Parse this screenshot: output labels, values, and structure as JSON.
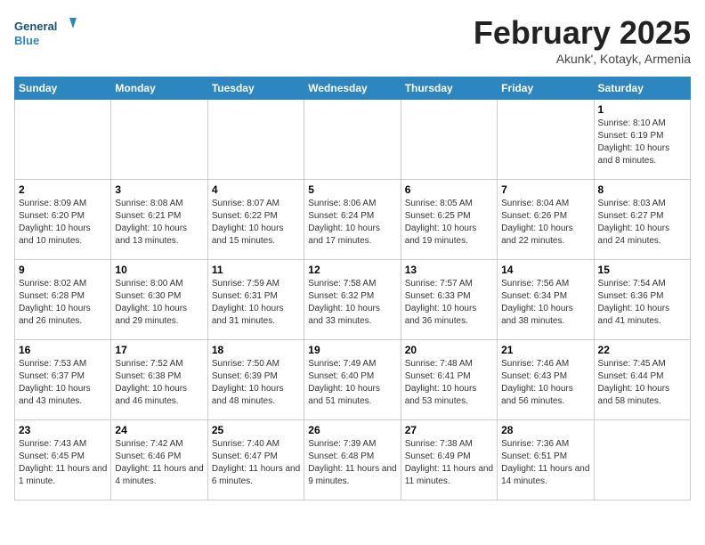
{
  "header": {
    "logo_line1": "General",
    "logo_line2": "Blue",
    "month": "February 2025",
    "location": "Akunk', Kotayk, Armenia"
  },
  "weekdays": [
    "Sunday",
    "Monday",
    "Tuesday",
    "Wednesday",
    "Thursday",
    "Friday",
    "Saturday"
  ],
  "weeks": [
    [
      {
        "day": "",
        "info": ""
      },
      {
        "day": "",
        "info": ""
      },
      {
        "day": "",
        "info": ""
      },
      {
        "day": "",
        "info": ""
      },
      {
        "day": "",
        "info": ""
      },
      {
        "day": "",
        "info": ""
      },
      {
        "day": "1",
        "info": "Sunrise: 8:10 AM\nSunset: 6:19 PM\nDaylight: 10 hours and 8 minutes."
      }
    ],
    [
      {
        "day": "2",
        "info": "Sunrise: 8:09 AM\nSunset: 6:20 PM\nDaylight: 10 hours and 10 minutes."
      },
      {
        "day": "3",
        "info": "Sunrise: 8:08 AM\nSunset: 6:21 PM\nDaylight: 10 hours and 13 minutes."
      },
      {
        "day": "4",
        "info": "Sunrise: 8:07 AM\nSunset: 6:22 PM\nDaylight: 10 hours and 15 minutes."
      },
      {
        "day": "5",
        "info": "Sunrise: 8:06 AM\nSunset: 6:24 PM\nDaylight: 10 hours and 17 minutes."
      },
      {
        "day": "6",
        "info": "Sunrise: 8:05 AM\nSunset: 6:25 PM\nDaylight: 10 hours and 19 minutes."
      },
      {
        "day": "7",
        "info": "Sunrise: 8:04 AM\nSunset: 6:26 PM\nDaylight: 10 hours and 22 minutes."
      },
      {
        "day": "8",
        "info": "Sunrise: 8:03 AM\nSunset: 6:27 PM\nDaylight: 10 hours and 24 minutes."
      }
    ],
    [
      {
        "day": "9",
        "info": "Sunrise: 8:02 AM\nSunset: 6:28 PM\nDaylight: 10 hours and 26 minutes."
      },
      {
        "day": "10",
        "info": "Sunrise: 8:00 AM\nSunset: 6:30 PM\nDaylight: 10 hours and 29 minutes."
      },
      {
        "day": "11",
        "info": "Sunrise: 7:59 AM\nSunset: 6:31 PM\nDaylight: 10 hours and 31 minutes."
      },
      {
        "day": "12",
        "info": "Sunrise: 7:58 AM\nSunset: 6:32 PM\nDaylight: 10 hours and 33 minutes."
      },
      {
        "day": "13",
        "info": "Sunrise: 7:57 AM\nSunset: 6:33 PM\nDaylight: 10 hours and 36 minutes."
      },
      {
        "day": "14",
        "info": "Sunrise: 7:56 AM\nSunset: 6:34 PM\nDaylight: 10 hours and 38 minutes."
      },
      {
        "day": "15",
        "info": "Sunrise: 7:54 AM\nSunset: 6:36 PM\nDaylight: 10 hours and 41 minutes."
      }
    ],
    [
      {
        "day": "16",
        "info": "Sunrise: 7:53 AM\nSunset: 6:37 PM\nDaylight: 10 hours and 43 minutes."
      },
      {
        "day": "17",
        "info": "Sunrise: 7:52 AM\nSunset: 6:38 PM\nDaylight: 10 hours and 46 minutes."
      },
      {
        "day": "18",
        "info": "Sunrise: 7:50 AM\nSunset: 6:39 PM\nDaylight: 10 hours and 48 minutes."
      },
      {
        "day": "19",
        "info": "Sunrise: 7:49 AM\nSunset: 6:40 PM\nDaylight: 10 hours and 51 minutes."
      },
      {
        "day": "20",
        "info": "Sunrise: 7:48 AM\nSunset: 6:41 PM\nDaylight: 10 hours and 53 minutes."
      },
      {
        "day": "21",
        "info": "Sunrise: 7:46 AM\nSunset: 6:43 PM\nDaylight: 10 hours and 56 minutes."
      },
      {
        "day": "22",
        "info": "Sunrise: 7:45 AM\nSunset: 6:44 PM\nDaylight: 10 hours and 58 minutes."
      }
    ],
    [
      {
        "day": "23",
        "info": "Sunrise: 7:43 AM\nSunset: 6:45 PM\nDaylight: 11 hours and 1 minute."
      },
      {
        "day": "24",
        "info": "Sunrise: 7:42 AM\nSunset: 6:46 PM\nDaylight: 11 hours and 4 minutes."
      },
      {
        "day": "25",
        "info": "Sunrise: 7:40 AM\nSunset: 6:47 PM\nDaylight: 11 hours and 6 minutes."
      },
      {
        "day": "26",
        "info": "Sunrise: 7:39 AM\nSunset: 6:48 PM\nDaylight: 11 hours and 9 minutes."
      },
      {
        "day": "27",
        "info": "Sunrise: 7:38 AM\nSunset: 6:49 PM\nDaylight: 11 hours and 11 minutes."
      },
      {
        "day": "28",
        "info": "Sunrise: 7:36 AM\nSunset: 6:51 PM\nDaylight: 11 hours and 14 minutes."
      },
      {
        "day": "",
        "info": ""
      }
    ]
  ]
}
